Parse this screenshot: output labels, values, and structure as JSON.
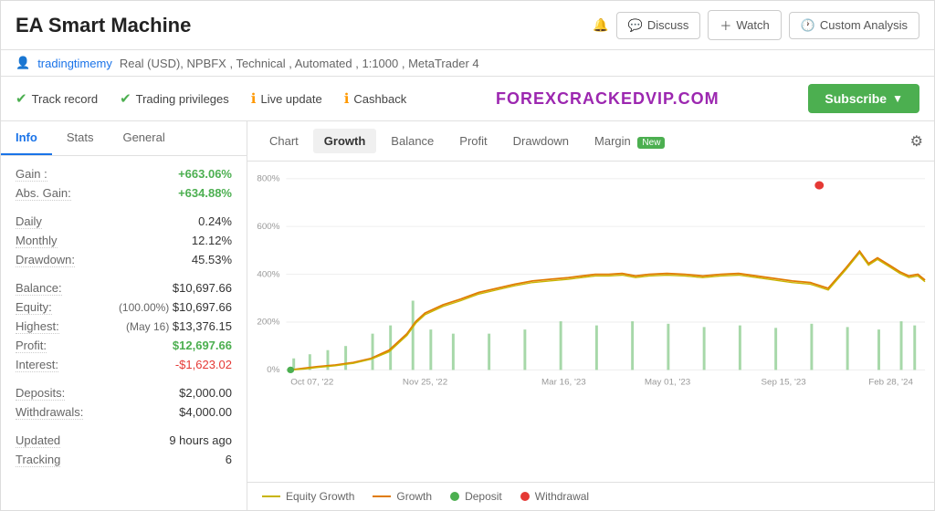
{
  "header": {
    "title": "EA Smart Machine",
    "discuss_label": "Discuss",
    "watch_label": "Watch",
    "custom_analysis_label": "Custom Analysis"
  },
  "user": {
    "username": "tradingtimemy",
    "details": "Real (USD), NPBFX , Technical , Automated , 1:1000 , MetaTrader 4"
  },
  "status": {
    "track_record": "Track record",
    "trading_privileges": "Trading privileges",
    "live_update": "Live update",
    "cashback": "Cashback",
    "watermark": "FOREXCRACKEDVIP.COM",
    "subscribe_label": "Subscribe"
  },
  "left_tabs": [
    {
      "label": "Info",
      "active": true
    },
    {
      "label": "Stats",
      "active": false
    },
    {
      "label": "General",
      "active": false
    }
  ],
  "stats": {
    "gain_label": "Gain :",
    "gain_value": "+663.06%",
    "abs_gain_label": "Abs. Gain:",
    "abs_gain_value": "+634.88%",
    "daily_label": "Daily",
    "daily_value": "0.24%",
    "monthly_label": "Monthly",
    "monthly_value": "12.12%",
    "drawdown_label": "Drawdown:",
    "drawdown_value": "45.53%",
    "balance_label": "Balance:",
    "balance_value": "$10,697.66",
    "equity_label": "Equity:",
    "equity_prefix": "(100.00%)",
    "equity_value": "$10,697.66",
    "highest_label": "Highest:",
    "highest_prefix": "(May 16)",
    "highest_value": "$13,376.15",
    "profit_label": "Profit:",
    "profit_value": "$12,697.66",
    "interest_label": "Interest:",
    "interest_value": "-$1,623.02",
    "deposits_label": "Deposits:",
    "deposits_value": "$2,000.00",
    "withdrawals_label": "Withdrawals:",
    "withdrawals_value": "$4,000.00",
    "updated_label": "Updated",
    "updated_value": "9 hours ago",
    "tracking_label": "Tracking",
    "tracking_value": "6"
  },
  "chart_tabs": [
    {
      "label": "Chart",
      "active": false
    },
    {
      "label": "Growth",
      "active": true
    },
    {
      "label": "Balance",
      "active": false
    },
    {
      "label": "Profit",
      "active": false
    },
    {
      "label": "Drawdown",
      "active": false
    },
    {
      "label": "Margin",
      "active": false,
      "badge": "New"
    }
  ],
  "chart": {
    "y_labels": [
      "800%",
      "600%",
      "400%",
      "200%",
      "0%"
    ],
    "x_labels": [
      "Oct 07, '22",
      "Nov 25, '22",
      "Mar 16, '23",
      "May 01, '23",
      "Sep 15, '23",
      "Feb 28, '24"
    ]
  },
  "legend": [
    {
      "label": "Equity Growth",
      "type": "line",
      "color": "#c8b400"
    },
    {
      "label": "Growth",
      "type": "line",
      "color": "#e07b00"
    },
    {
      "label": "Deposit",
      "type": "dot",
      "color": "#4caf50"
    },
    {
      "label": "Withdrawal",
      "type": "dot",
      "color": "#e53935"
    }
  ]
}
